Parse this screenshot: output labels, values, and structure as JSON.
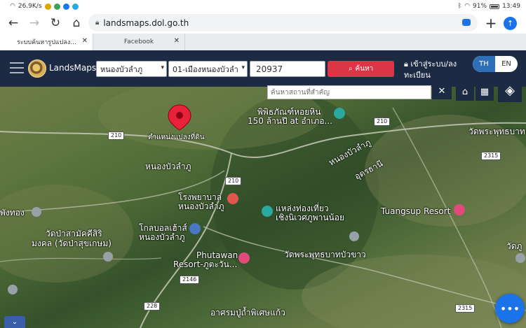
{
  "status_bar": {
    "net_speed": "26.9K/s",
    "battery": "91%",
    "time": "13:49"
  },
  "browser": {
    "url": "landsmaps.dol.go.th",
    "tabs": [
      {
        "title": "ระบบค้นหารูปแปลง..."
      },
      {
        "title": "Facebook"
      }
    ]
  },
  "header": {
    "app_name": "LandsMaps",
    "district_select": "หนองบัวลำภู",
    "office_select": "01-เมืองหนองบัวลำ",
    "parcel_value": "20937",
    "search_label": "ค้นหา",
    "login_label": "เข้าสู่ระบบ/ลงทะเบียน",
    "lang_th": "TH",
    "lang_en": "EN"
  },
  "map": {
    "search_placeholder": "ค้นหาสถานที่สำคัญ",
    "pin_label": "ตำแหน่งแปลงที่ดิน",
    "places": [
      "พิพิธภัณฑ์หอยหิน",
      "150 ล้านปี at อำเภอ...",
      "หนองบัวลำภู",
      "หนองบัวลำภู",
      "อุดรธานี",
      "โรงพยาบาล",
      "หนองบัวลำภู",
      "แหล่งท่องเที่ยว",
      "เชิงนิเวศภูพานน้อย",
      "Tuangsup Resort",
      "พังทอง",
      "วัดป่าสามัคคีสิริ",
      "มงคล (วัดป่าสุขเกษม)",
      "โกลบอลเฮ้าส์",
      "หนองบัวลำภู",
      "Phutawan",
      "Resort-ภูตะวัน...",
      "วัดพระพุทธบาทบัวขาว",
      "อาศรมปู่ถ้ำพิเศษแก้ว",
      "วัดพระพุทธบาท",
      "วัดภู"
    ],
    "roads": [
      "210",
      "210",
      "210",
      "2315",
      "2146",
      "228",
      "2315"
    ]
  }
}
